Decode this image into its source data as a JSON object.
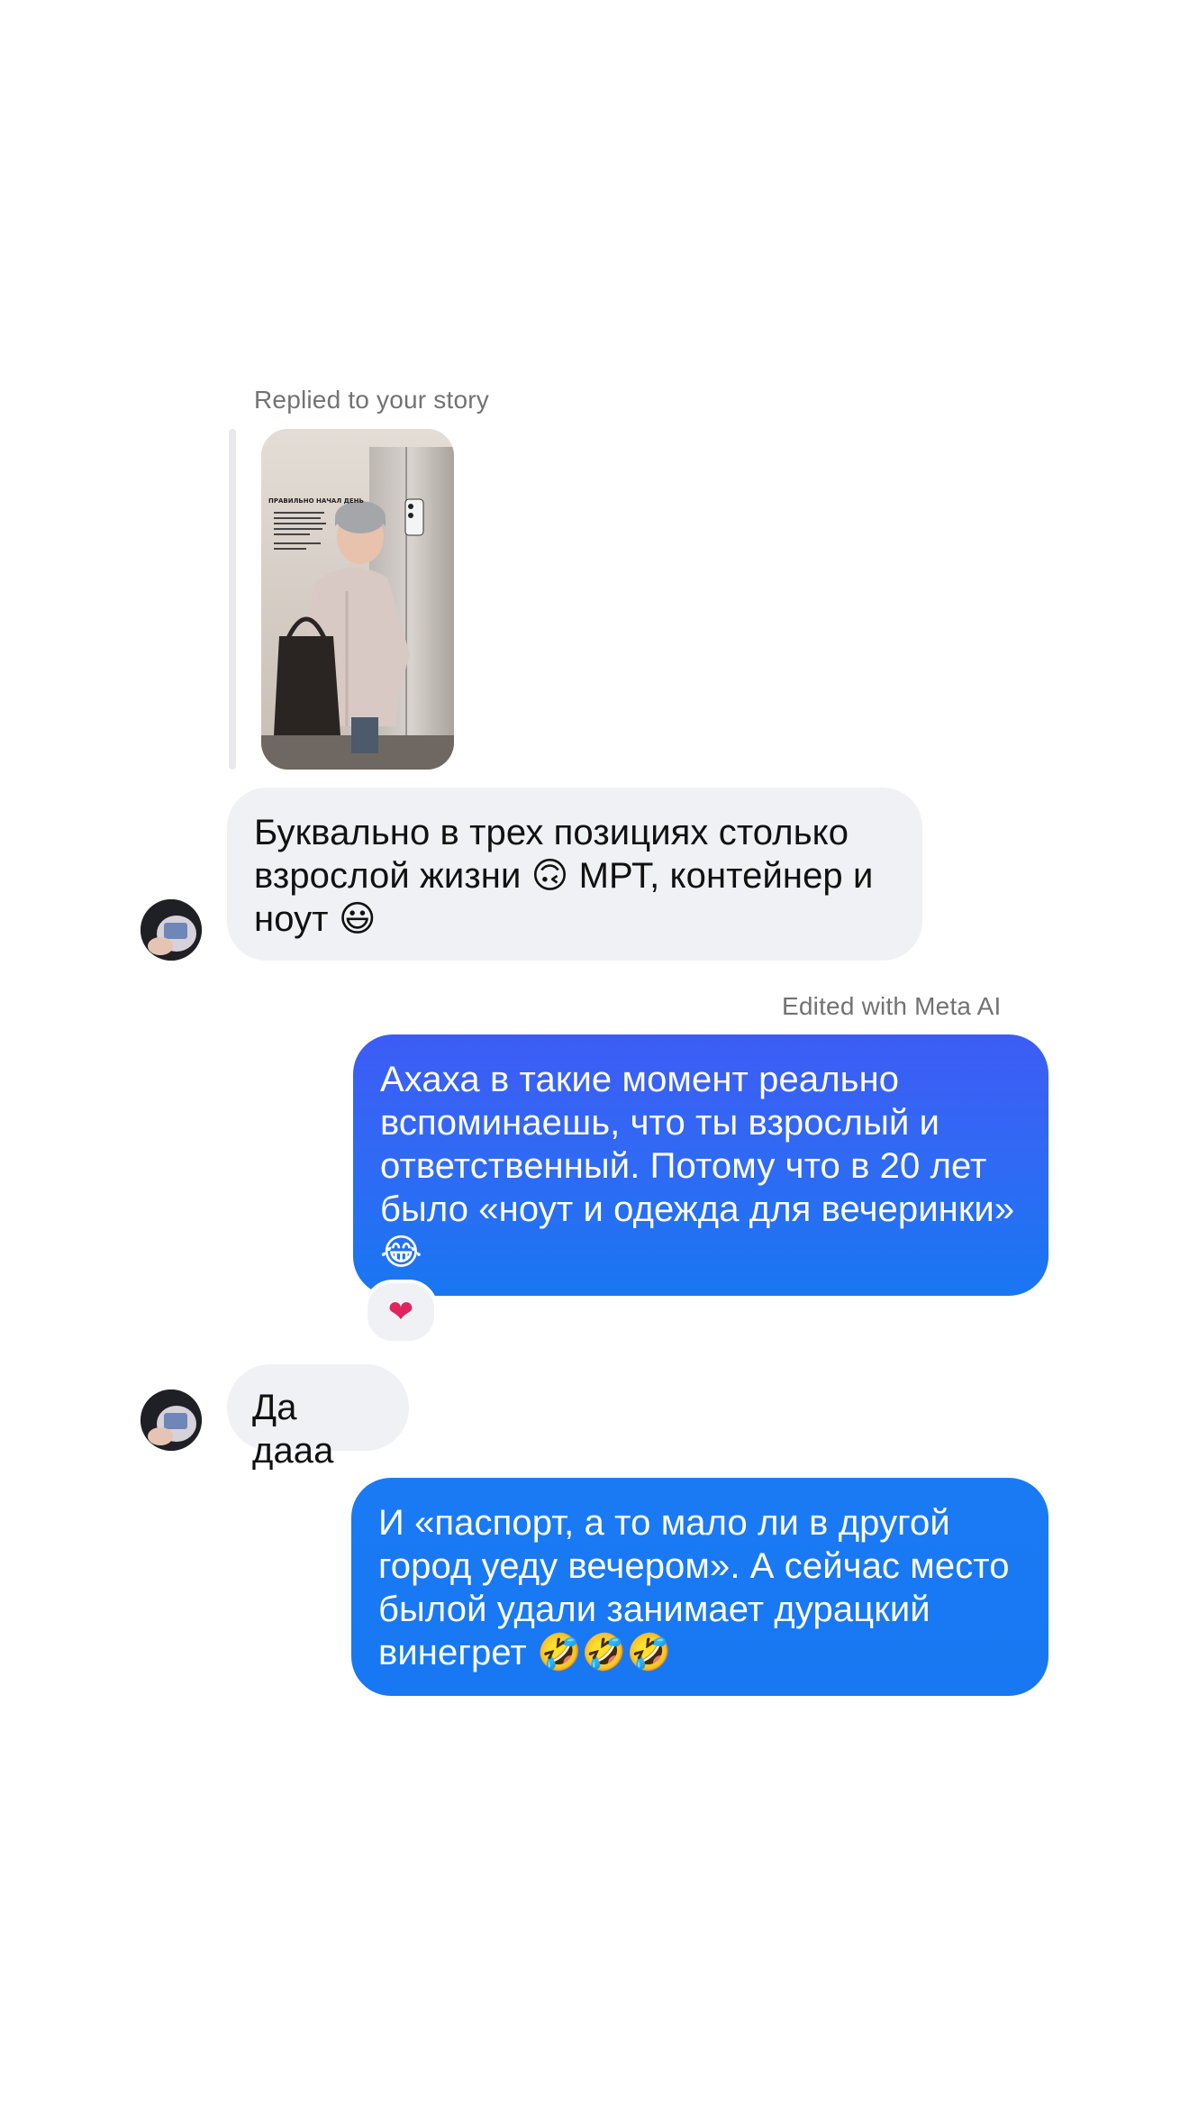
{
  "thread": {
    "replied_label": "Replied to your story",
    "edited_label": "Edited with Meta AI",
    "story_preview": {
      "caption_title": "ПРАВИЛЬНО НАЧАЛ ДЕНЬ"
    },
    "messages": [
      {
        "direction": "in",
        "text": "Буквально в трех позициях столько\nвзрослой жизни 🙃 МРТ, контейнер и\nноут 😃"
      },
      {
        "direction": "out",
        "text": "Ахаха в такие момент реально\nвспоминаешь, что ты взрослый и\nответственный. Потому что в 20 лет\nбыло «ноут и одежда для вечеринки»\n😂",
        "reaction": "❤"
      },
      {
        "direction": "in",
        "text": "Да дааа"
      },
      {
        "direction": "out",
        "text": "И «паспорт, а то мало ли в другой\nгород уеду вечером». А сейчас место\nбылой удали занимает дурацкий\nвинегрет 🤣🤣🤣"
      }
    ]
  },
  "colors": {
    "incoming_bubble": "#f0f1f4",
    "outgoing_gradient_top": "#3d5cf5",
    "outgoing_gradient_bottom": "#1877f2",
    "meta_text": "#737373",
    "heart": "#e0245e"
  }
}
